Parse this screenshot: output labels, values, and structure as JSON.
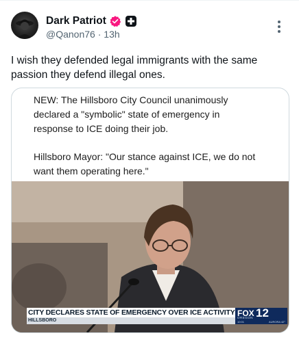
{
  "post": {
    "display_name": "Dark Patriot",
    "handle": "@Qanon76",
    "separator": "·",
    "time": "13h",
    "text": "I wish they defended legal immigrants with the same passion they defend illegal ones.",
    "icons": {
      "verified": "verified-badge-icon",
      "affiliate": "affiliate-badge-icon",
      "more": "more-options-icon"
    },
    "colors": {
      "verified_badge": "#f91880",
      "secondary_text": "#536471"
    }
  },
  "media": {
    "quote_paragraph_1": "NEW: The Hillsboro City Council unanimously declared a \"symbolic\" state of emergency in response to ICE doing their job.",
    "quote_paragraph_2": "Hillsboro Mayor: \"Our stance against ICE, we do not want them operating here.\"",
    "video": {
      "headline": "CITY DECLARES STATE OF EMERGENCY OVER ICE ACTIVITY",
      "location": "HILLSBORO",
      "station_name": "FOX",
      "station_number": "12",
      "station_region": "OREGON",
      "time_readout": "10:01",
      "weather_readout": "AURORA 42°"
    }
  }
}
